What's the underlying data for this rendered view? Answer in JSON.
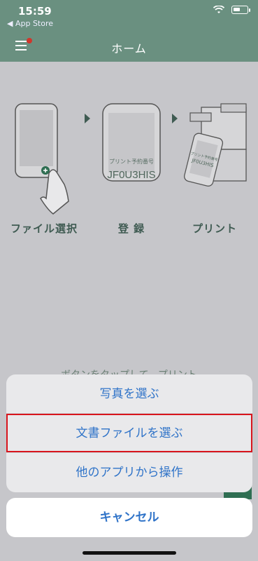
{
  "status": {
    "time": "15:59",
    "back_app": "◀ App Store"
  },
  "nav": {
    "title": "ホーム"
  },
  "steps": [
    {
      "label": "ファイル選択"
    },
    {
      "label": "登 録"
    },
    {
      "label": "プリント"
    }
  ],
  "phone_card": {
    "caption": "プリント予約番号",
    "code": "JF0U3HIS"
  },
  "hint": {
    "text": "ボタンをタップして、プリント"
  },
  "action_sheet": {
    "items": [
      {
        "label": "写真を選ぶ"
      },
      {
        "label": "文書ファイルを選ぶ"
      },
      {
        "label": "他のアプリから操作"
      }
    ],
    "cancel_label": "キャンセル"
  },
  "colors": {
    "brand": "#6a9080",
    "accent": "#2f73c8",
    "highlight": "#d8151d"
  },
  "icons": {
    "menu": "hamburger-menu-icon",
    "wifi": "wifi-icon",
    "battery": "battery-icon"
  }
}
